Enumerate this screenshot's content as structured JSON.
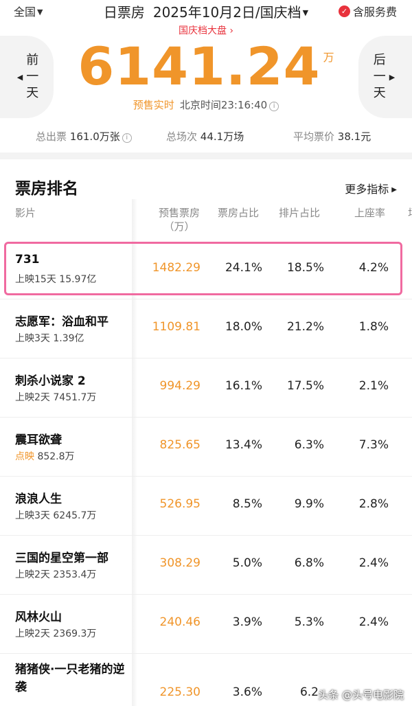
{
  "header": {
    "region": "全国",
    "title_main": "日票房",
    "title_date": "2025年10月2日/国庆档",
    "service": "含服务费",
    "guoqing_link": "国庆档大盘 ›"
  },
  "nav": {
    "prev_day": "前一天",
    "next_day": "后一天"
  },
  "summary": {
    "total": "6141.24",
    "unit": "万",
    "presale_tag": "预售实时",
    "beijing_time": "北京时间23:16:40"
  },
  "stats": {
    "tickets_label": "总出票",
    "tickets_value": "161.0万张",
    "shows_label": "总场次",
    "shows_value": "44.1万场",
    "avg_label": "平均票价",
    "avg_value": "38.1元"
  },
  "ranking": {
    "title": "票房排名",
    "more": "更多指标",
    "columns": {
      "film": "影片",
      "gross": "预售票房",
      "gross_unit": "（万）",
      "share": "票房占比",
      "screens": "排片占比",
      "occupancy": "上座率",
      "extra": "场"
    },
    "rows": [
      {
        "name": "731",
        "status": "上映15天",
        "cumulative": "15.97亿",
        "gross": "1482.29",
        "share": "24.1%",
        "screens": "18.5%",
        "occupancy": "4.2%"
      },
      {
        "name": "志愿军：浴血和平",
        "status": "上映3天",
        "cumulative": "1.39亿",
        "gross": "1109.81",
        "share": "18.0%",
        "screens": "21.2%",
        "occupancy": "1.8%"
      },
      {
        "name": "刺杀小说家 2",
        "status": "上映2天",
        "cumulative": "7451.7万",
        "gross": "994.29",
        "share": "16.1%",
        "screens": "17.5%",
        "occupancy": "2.1%"
      },
      {
        "name": "震耳欲聋",
        "status": "点映",
        "cumulative": "852.8万",
        "gross": "825.65",
        "share": "13.4%",
        "screens": "6.3%",
        "occupancy": "7.3%"
      },
      {
        "name": "浪浪人生",
        "status": "上映3天",
        "cumulative": "6245.7万",
        "gross": "526.95",
        "share": "8.5%",
        "screens": "9.9%",
        "occupancy": "2.8%"
      },
      {
        "name": "三国的星空第一部",
        "status": "上映2天",
        "cumulative": "2353.4万",
        "gross": "308.29",
        "share": "5.0%",
        "screens": "6.8%",
        "occupancy": "2.4%"
      },
      {
        "name": "风林火山",
        "status": "上映2天",
        "cumulative": "2369.3万",
        "gross": "240.46",
        "share": "3.9%",
        "screens": "5.3%",
        "occupancy": "2.4%"
      },
      {
        "name": "猪猪侠·一只老猪的逆袭",
        "status": "",
        "cumulative": "",
        "gross": "225.30",
        "share": "3.6%",
        "screens": "6.2",
        "occupancy": ""
      }
    ]
  },
  "watermark": "头条 @头号电影院",
  "colors": {
    "accent_orange": "#f0952a",
    "accent_red": "#e8323c",
    "highlight_pink": "#f06aa0"
  }
}
